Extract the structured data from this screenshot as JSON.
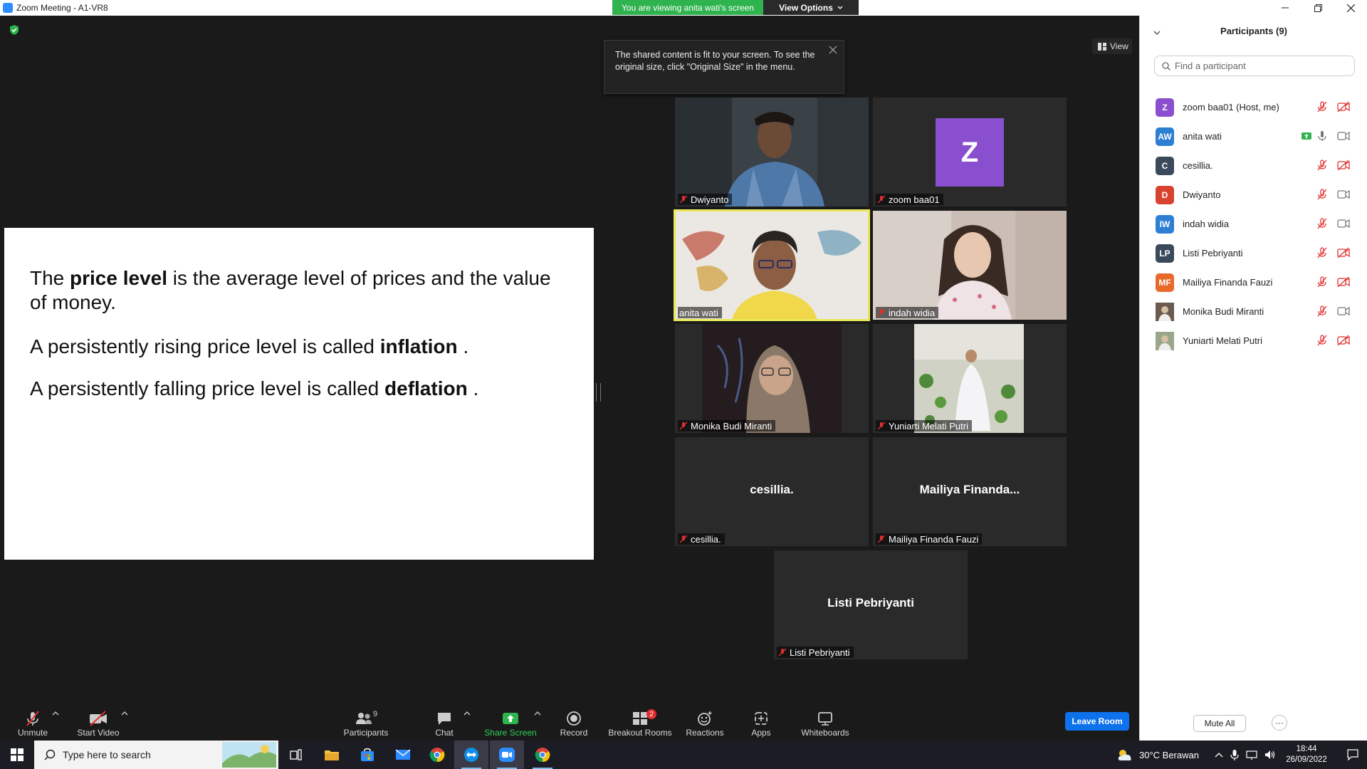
{
  "window": {
    "title": "Zoom Meeting - A1-VR8",
    "viewing_banner": "You are viewing anita wati's screen",
    "view_options": "View Options"
  },
  "tooltip": {
    "text": "The shared content is fit to your screen. To see the original size, click \"Original Size\" in the menu."
  },
  "view_button": "View",
  "slide": {
    "line1_pre": "The ",
    "line1_bold": "price level",
    "line1_post": "  is the average level of prices and the value of money.",
    "line2_pre": "A persistently rising price level is called ",
    "line2_bold": "inflation",
    "line2_post": " .",
    "line3_pre": "A persistently falling price level is called ",
    "line3_bold": "deflation",
    "line3_post": " ."
  },
  "tiles": [
    {
      "name": "Dwiyanto",
      "muted": true
    },
    {
      "name": "zoom baa01",
      "avatar_letter": "Z",
      "muted": true
    },
    {
      "name": "anita wati",
      "muted": false,
      "active_speaker": true
    },
    {
      "name": "indah widia",
      "muted": true
    },
    {
      "name": "Monika Budi Miranti",
      "muted": true
    },
    {
      "name": "Yuniarti Melati Putri",
      "muted": true
    },
    {
      "name": "cesillia.",
      "display": "cesillia.",
      "muted": true
    },
    {
      "name": "Mailiya Finanda Fauzi",
      "display": "Mailiya  Finanda...",
      "muted": true
    },
    {
      "name": "Listi Pebriyanti",
      "display": "Listi Pebriyanti",
      "muted": true
    }
  ],
  "toolbar": {
    "unmute": "Unmute",
    "start_video": "Start Video",
    "participants": "Participants",
    "participants_count": "9",
    "chat": "Chat",
    "share_screen": "Share Screen",
    "record": "Record",
    "breakout_rooms": "Breakout Rooms",
    "breakout_badge": "2",
    "reactions": "Reactions",
    "apps": "Apps",
    "whiteboards": "Whiteboards",
    "leave_room": "Leave Room"
  },
  "panel": {
    "title": "Participants (9)",
    "search_placeholder": "Find a participant",
    "mute_all": "Mute All",
    "more": "···",
    "participants": [
      {
        "initials": "Z",
        "name": "zoom baa01 (Host, me)",
        "color": "#8a4fcf",
        "mic": "muted",
        "video": "off"
      },
      {
        "initials": "AW",
        "name": "anita wati",
        "color": "#2d7fd3",
        "sharing": true,
        "mic": "on",
        "video": "on"
      },
      {
        "initials": "C",
        "name": "cesillia.",
        "color": "#3a4a5c",
        "mic": "muted",
        "video": "off"
      },
      {
        "initials": "D",
        "name": "Dwiyanto",
        "color": "#d8432f",
        "mic": "muted",
        "video": "on"
      },
      {
        "initials": "IW",
        "name": "indah widia",
        "color": "#2d7fd3",
        "mic": "muted",
        "video": "on"
      },
      {
        "initials": "LP",
        "name": "Listi Pebriyanti",
        "color": "#3a4a5c",
        "mic": "muted",
        "video": "off"
      },
      {
        "initials": "MF",
        "name": "Mailiya Finanda Fauzi",
        "color": "#e8692a",
        "mic": "muted",
        "video": "off"
      },
      {
        "initials": "",
        "name": "Monika Budi Miranti",
        "color": "#6b5a4e",
        "photo": true,
        "mic": "muted",
        "video": "on"
      },
      {
        "initials": "",
        "name": "Yuniarti Melati Putri",
        "color": "#9aa68a",
        "photo": true,
        "mic": "muted",
        "video": "off"
      }
    ]
  },
  "taskbar": {
    "search_placeholder": "Type here to search",
    "weather": "30°C  Berawan",
    "time": "18:44",
    "date": "26/09/2022"
  },
  "colors": {
    "accent_green": "#2fb34f",
    "accent_blue": "#0e72ed",
    "muted_red": "#e02f2f",
    "active_speaker": "#e9e85a"
  }
}
